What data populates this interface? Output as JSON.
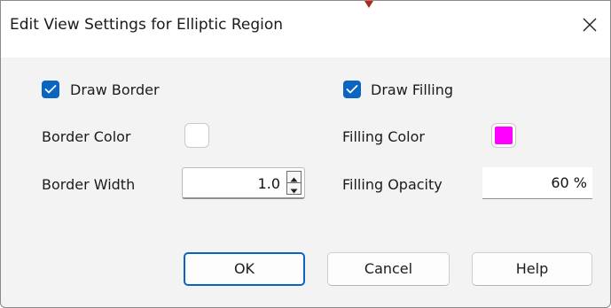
{
  "window": {
    "title": "Edit View Settings for Elliptic Region",
    "close_symbol": "close-icon"
  },
  "border": {
    "draw_label": "Draw Border",
    "draw_checked": true,
    "color_label": "Border Color",
    "color_value": "#ffffff",
    "width_label": "Border Width",
    "width_value": "1.0"
  },
  "filling": {
    "draw_label": "Draw Filling",
    "draw_checked": true,
    "color_label": "Filling Color",
    "color_value": "#ff00ff",
    "opacity_label": "Filling Opacity",
    "opacity_value": "60 %"
  },
  "buttons": {
    "ok": "OK",
    "cancel": "Cancel",
    "help": "Help"
  },
  "colors": {
    "accent": "#0a64c2",
    "dialog_bg": "#f3f3f3",
    "pointer": "#b5261e"
  }
}
